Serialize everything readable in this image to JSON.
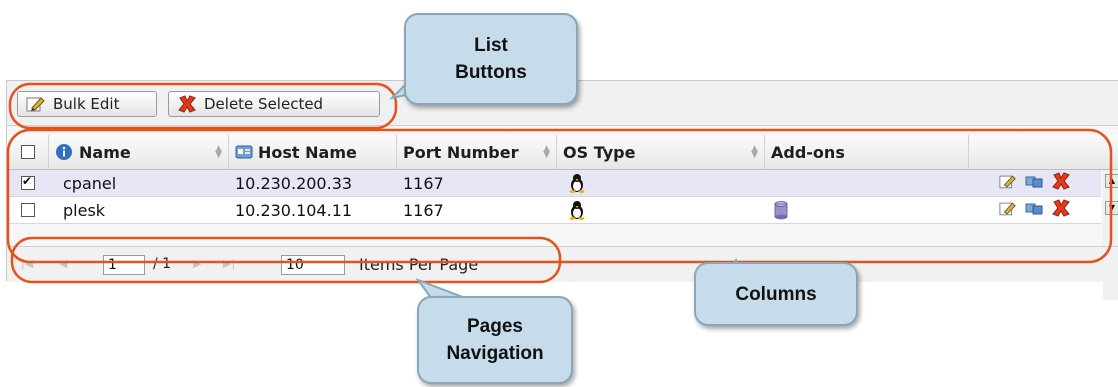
{
  "toolbar": {
    "bulk_edit_label": "Bulk Edit",
    "delete_selected_label": "Delete Selected"
  },
  "table": {
    "columns": [
      "Name",
      "Host Name",
      "Port Number",
      "OS Type",
      "Add-ons"
    ],
    "rows": [
      {
        "name": "cpanel",
        "host": "10.230.200.33",
        "port": "1167",
        "os_icon": "linux-tux-icon",
        "addon_icon": "",
        "checked": true
      },
      {
        "name": "plesk",
        "host": "10.230.104.11",
        "port": "1167",
        "os_icon": "linux-tux-icon",
        "addon_icon": "database-icon",
        "checked": false
      }
    ],
    "row_action_icons": [
      "edit-icon",
      "copy-icon",
      "delete-icon"
    ]
  },
  "pager": {
    "current_page": "1",
    "total_pages": "/ 1",
    "items_per_page": "10",
    "items_per_page_label": "Items Per Page"
  },
  "callouts": {
    "list_buttons_line1": "List",
    "list_buttons_line2": "Buttons",
    "columns": "Columns",
    "pages_line1": "Pages",
    "pages_line2": "Navigation"
  },
  "colors": {
    "highlight": "#e4531c",
    "callout_fill": "#c6dcea",
    "selected_row": "#e6e6f7"
  }
}
